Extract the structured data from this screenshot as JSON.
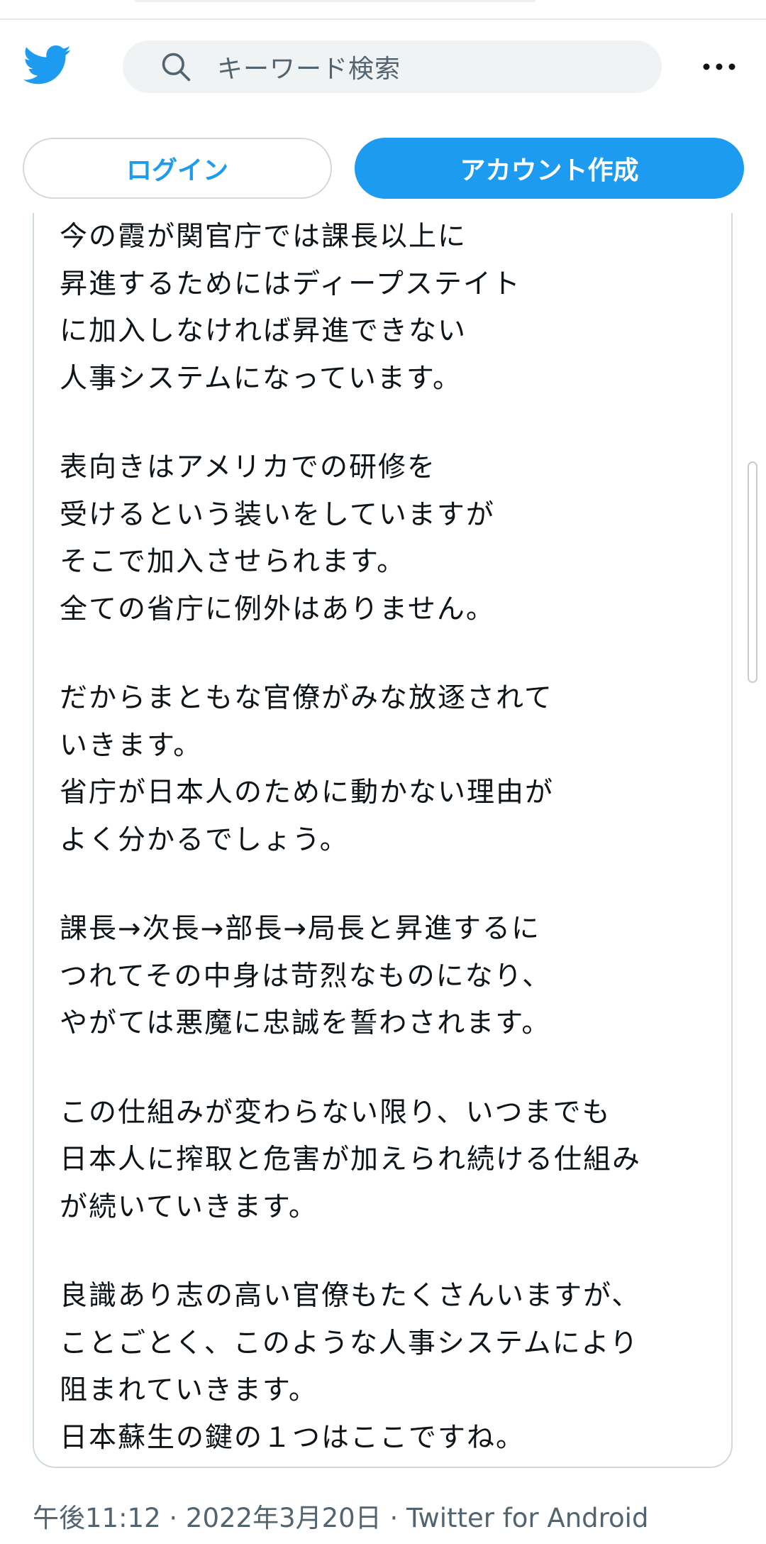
{
  "header": {
    "logo_icon": "twitter-bird-icon",
    "search_placeholder": "キーワード検索",
    "search_icon": "search-icon",
    "more_icon": "more-dots-icon",
    "login_label": "ログイン",
    "signup_label": "アカウント作成"
  },
  "colors": {
    "accent": "#1d9bf0",
    "text": "#0f1419",
    "muted": "#536471",
    "border": "#cfd9de"
  },
  "tweet": {
    "paragraphs": [
      {
        "lines": [
          "今の霞が関官庁では課長以上に",
          "昇進するためにはディープステイト",
          "に加入しなければ昇進できない",
          "人事システムになっています。"
        ]
      },
      {
        "lines": [
          "表向きはアメリカでの研修を",
          "受けるという装いをしていますが",
          "そこで加入させられます。",
          "全ての省庁に例外はありません。"
        ]
      },
      {
        "lines": [
          "だからまともな官僚がみな放逐されて",
          "いきます。",
          "省庁が日本人のために動かない理由が",
          "よく分かるでしょう。"
        ]
      },
      {
        "lines": [
          "課長→次長→部長→局長と昇進するに",
          "つれてその中身は苛烈なものになり、",
          "やがては悪魔に忠誠を誓わされます。"
        ]
      },
      {
        "lines": [
          "この仕組みが変わらない限り、いつまでも",
          "日本人に搾取と危害が加えられ続ける仕組み",
          "が続いていきます。"
        ]
      },
      {
        "lines": [
          "良識あり志の高い官僚もたくさんいますが、",
          "ことごとく、このような人事システムにより",
          "阻まれていきます。",
          "日本蘇生の鍵の１つはここですね。"
        ]
      }
    ],
    "meta": "午後11:12 · 2022年3月20日 · Twitter for Android"
  }
}
